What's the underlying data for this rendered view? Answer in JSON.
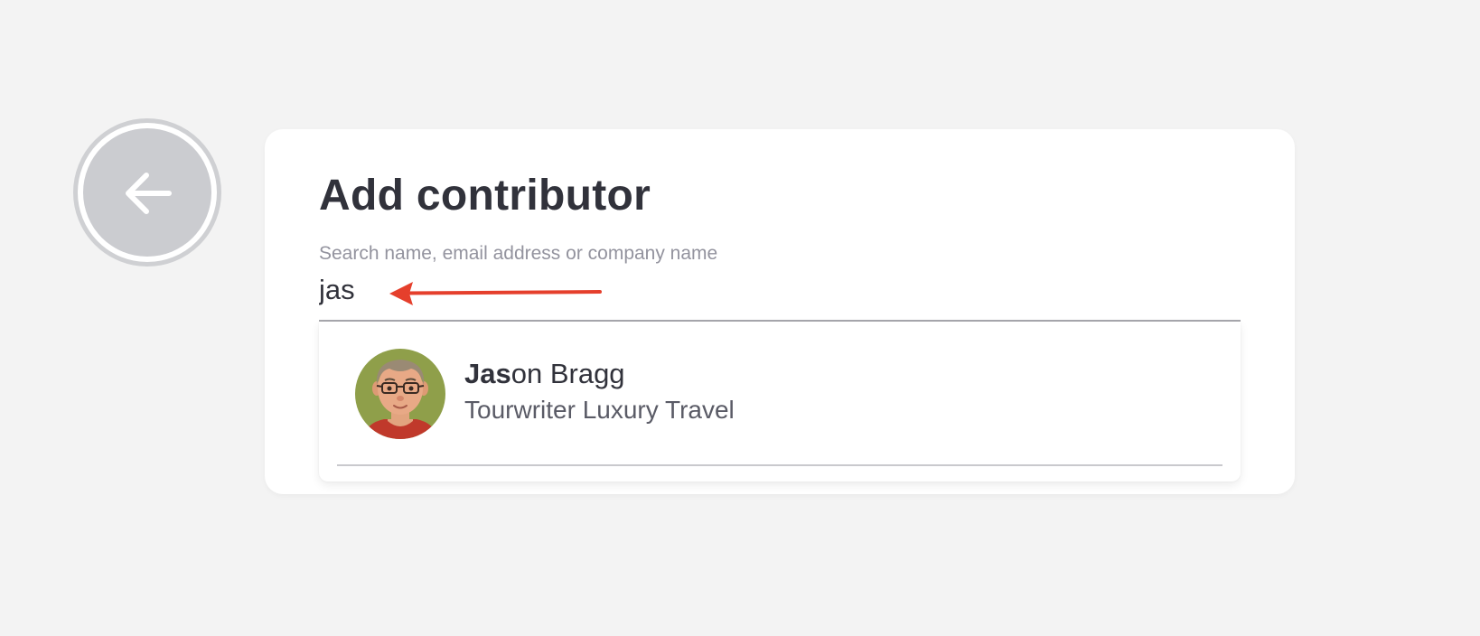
{
  "back_button": {
    "icon": "arrow-left-icon",
    "colors": {
      "ring": "#cfd0d3",
      "fill": "#cbccd0",
      "icon": "#ffffff"
    }
  },
  "dialog": {
    "title": "Add contributor",
    "search": {
      "label": "Search name, email address or company name",
      "value": "jas"
    },
    "results": [
      {
        "name_match": "Jas",
        "name_rest": "on Bragg",
        "company": "Tourwriter Luxury Travel",
        "avatar_icon": "person-avatar-icon"
      }
    ]
  },
  "annotation": {
    "icon": "arrow-left-icon",
    "color": "#e53f2c"
  },
  "colors": {
    "background": "#f3f3f3",
    "card": "#ffffff",
    "title": "#31323b",
    "label": "#93939e",
    "avatar_background": "#8f9f4a"
  }
}
